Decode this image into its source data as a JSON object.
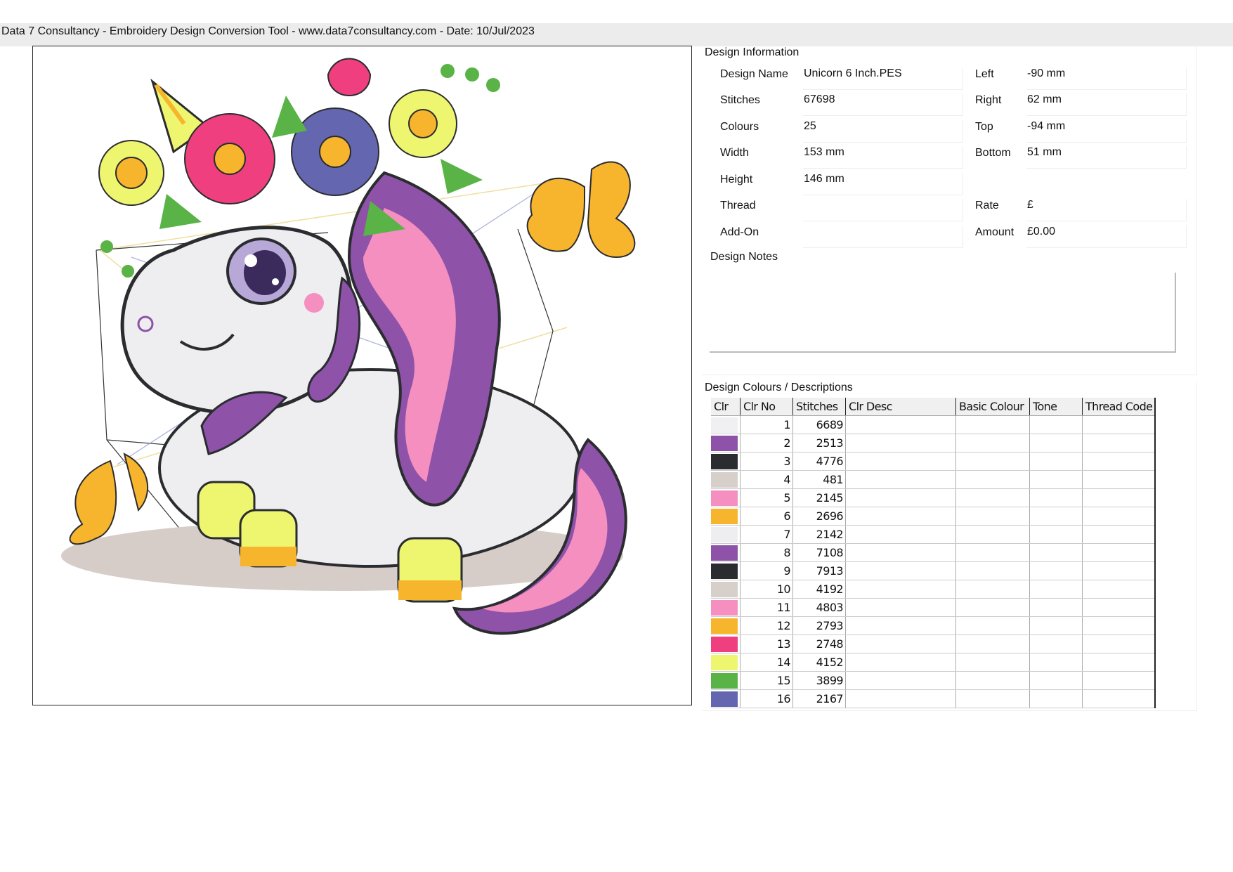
{
  "header": {
    "title": "Data 7 Consultancy - Embroidery Design Conversion Tool - www.data7consultancy.com - Date: 10/Jul/2023"
  },
  "design_info": {
    "section_title": "Design Information",
    "fields_left": [
      {
        "label": "Design Name",
        "value": "Unicorn 6 Inch.PES"
      },
      {
        "label": "Stitches",
        "value": "67698"
      },
      {
        "label": "Colours",
        "value": "25"
      },
      {
        "label": "Width",
        "value": "153 mm"
      },
      {
        "label": "Height",
        "value": "146 mm"
      },
      {
        "label": "Thread",
        "value": ""
      },
      {
        "label": "Add-On",
        "value": ""
      }
    ],
    "fields_right": [
      {
        "label": "Left",
        "value": "-90 mm"
      },
      {
        "label": "Right",
        "value": "62 mm"
      },
      {
        "label": "Top",
        "value": "-94 mm"
      },
      {
        "label": "Bottom",
        "value": "51 mm"
      },
      {
        "label": "Rate",
        "value": "£"
      },
      {
        "label": "Amount",
        "value": "£0.00"
      }
    ],
    "notes_label": "Design Notes",
    "notes": ""
  },
  "colours": {
    "section_title": "Design Colours / Descriptions",
    "columns": [
      "Clr",
      "Clr No",
      "Stitches",
      "Clr Desc",
      "Basic Colour",
      "Tone",
      "Thread Code"
    ],
    "rows": [
      {
        "color": "#f0f0f2",
        "no": "1",
        "stitches": "6689"
      },
      {
        "color": "#8e52a8",
        "no": "2",
        "stitches": "2513"
      },
      {
        "color": "#2a2c30",
        "no": "3",
        "stitches": "4776"
      },
      {
        "color": "#d6cfca",
        "no": "4",
        "stitches": "481"
      },
      {
        "color": "#f48fc0",
        "no": "5",
        "stitches": "2145"
      },
      {
        "color": "#f7b52e",
        "no": "6",
        "stitches": "2696"
      },
      {
        "color": "#eeeef0",
        "no": "7",
        "stitches": "2142"
      },
      {
        "color": "#8e52a8",
        "no": "8",
        "stitches": "7108"
      },
      {
        "color": "#2a2c30",
        "no": "9",
        "stitches": "7913"
      },
      {
        "color": "#d6cfca",
        "no": "10",
        "stitches": "4192"
      },
      {
        "color": "#f48fc0",
        "no": "11",
        "stitches": "4803"
      },
      {
        "color": "#f7b52e",
        "no": "12",
        "stitches": "2793"
      },
      {
        "color": "#ef3f7f",
        "no": "13",
        "stitches": "2748"
      },
      {
        "color": "#eef56e",
        "no": "14",
        "stitches": "4152"
      },
      {
        "color": "#59b346",
        "no": "15",
        "stitches": "3899"
      },
      {
        "color": "#6566b0",
        "no": "16",
        "stitches": "2167"
      }
    ]
  }
}
